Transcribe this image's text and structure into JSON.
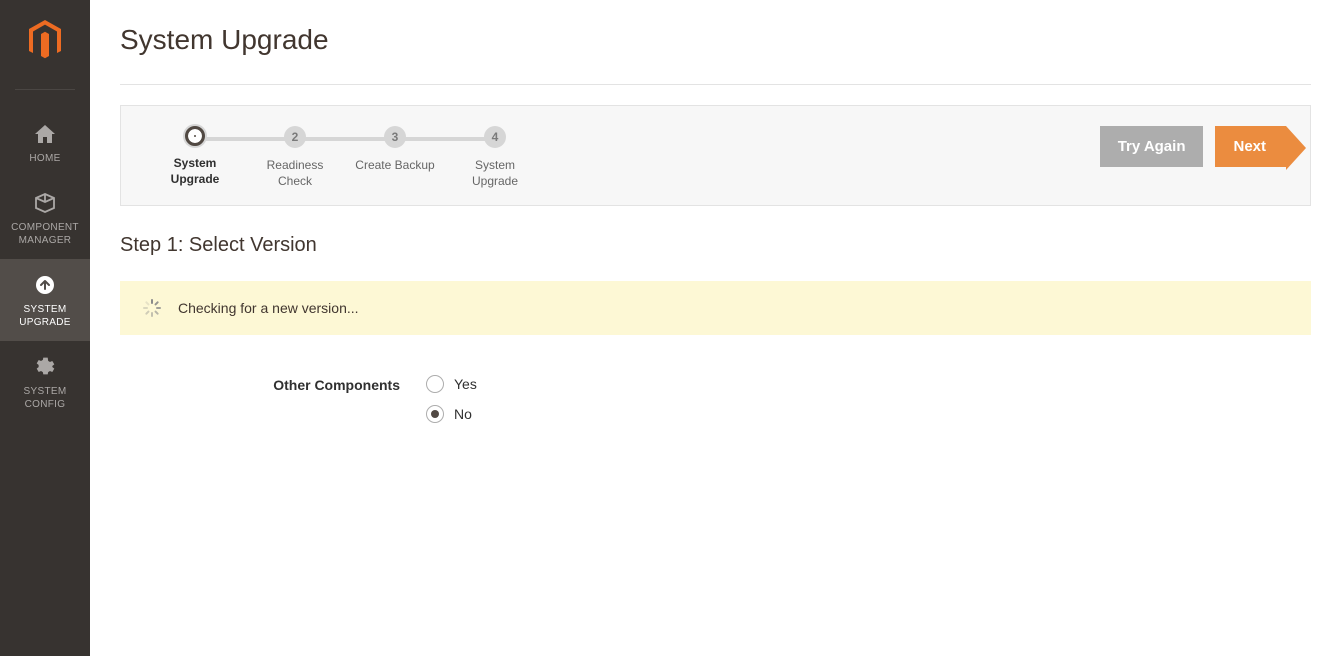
{
  "sidebar": {
    "items": [
      {
        "label": "HOME"
      },
      {
        "label": "COMPONENT\nMANAGER"
      },
      {
        "label": "SYSTEM\nUPGRADE"
      },
      {
        "label": "SYSTEM\nCONFIG"
      }
    ]
  },
  "header": {
    "title": "System Upgrade"
  },
  "wizard": {
    "steps": [
      {
        "num": "",
        "label": "System\nUpgrade"
      },
      {
        "num": "2",
        "label": "Readiness\nCheck"
      },
      {
        "num": "3",
        "label": "Create Backup"
      },
      {
        "num": "4",
        "label": "System\nUpgrade"
      }
    ],
    "try_again_label": "Try Again",
    "next_label": "Next"
  },
  "step_heading": "Step 1: Select Version",
  "notice": {
    "text": "Checking for a new version..."
  },
  "form": {
    "other_components_label": "Other Components",
    "options": {
      "yes": "Yes",
      "no": "No"
    }
  }
}
